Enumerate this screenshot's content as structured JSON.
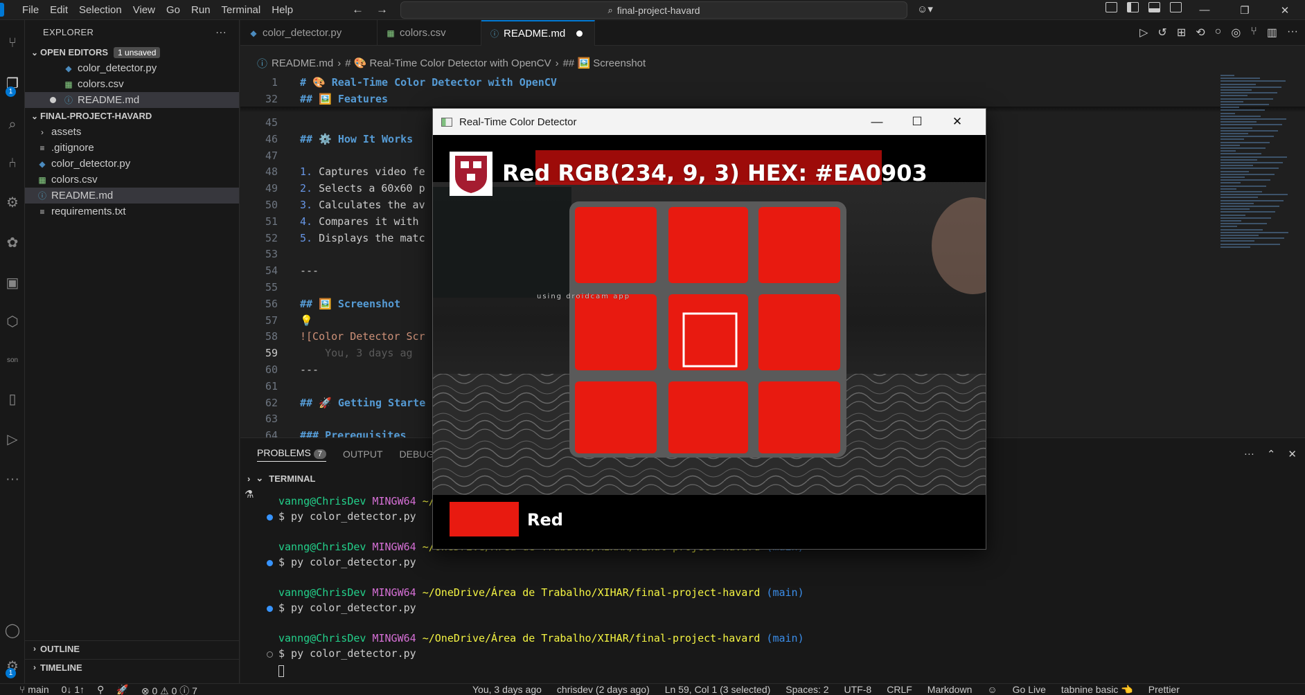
{
  "menu": [
    "File",
    "Edit",
    "Selection",
    "View",
    "Go",
    "Run",
    "Terminal",
    "Help"
  ],
  "search": {
    "text": "final-project-havard"
  },
  "explorer": {
    "title": "EXPLORER",
    "open_editors_label": "OPEN EDITORS",
    "unsaved_badge": "1 unsaved",
    "open_editors": [
      {
        "name": "color_detector.py",
        "type": "py"
      },
      {
        "name": "colors.csv",
        "type": "csv"
      },
      {
        "name": "README.md",
        "type": "md"
      }
    ],
    "project_label": "FINAL-PROJECT-HAVARD",
    "files": [
      {
        "name": "assets",
        "type": "folder"
      },
      {
        "name": ".gitignore",
        "type": "txt"
      },
      {
        "name": "color_detector.py",
        "type": "py"
      },
      {
        "name": "colors.csv",
        "type": "csv"
      },
      {
        "name": "README.md",
        "type": "md"
      },
      {
        "name": "requirements.txt",
        "type": "txt"
      }
    ],
    "outline_label": "OUTLINE",
    "timeline_label": "TIMELINE"
  },
  "tabs": [
    {
      "label": "color_detector.py",
      "type": "py"
    },
    {
      "label": "colors.csv",
      "type": "csv"
    },
    {
      "label": "README.md",
      "type": "md"
    }
  ],
  "breadcrumb": {
    "file": "README.md",
    "h1": "# 🎨 Real-Time Color Detector with OpenCV",
    "h2": "## 🖼️ Screenshot"
  },
  "editor": {
    "sticky": [
      {
        "n": "1",
        "mark": "# 🎨 ",
        "text": "Real-Time Color Detector with OpenCV"
      },
      {
        "n": "32",
        "mark": "## 🖼️ ",
        "text": "Features"
      }
    ],
    "lines": [
      {
        "n": "45",
        "kind": "blank",
        "text": ""
      },
      {
        "n": "46",
        "kind": "heading",
        "mark": "## ⚙️ ",
        "text": "How It Works"
      },
      {
        "n": "47",
        "kind": "blank",
        "text": ""
      },
      {
        "n": "48",
        "kind": "list",
        "mark": "1.",
        "text": " Captures video fe"
      },
      {
        "n": "49",
        "kind": "list",
        "mark": "2.",
        "text": " Selects a 60x60 p"
      },
      {
        "n": "50",
        "kind": "list",
        "mark": "3.",
        "text": " Calculates the av"
      },
      {
        "n": "51",
        "kind": "list",
        "mark": "4.",
        "text": " Compares it with "
      },
      {
        "n": "52",
        "kind": "list",
        "mark": "5.",
        "text": " Displays the matc"
      },
      {
        "n": "53",
        "kind": "blank",
        "text": ""
      },
      {
        "n": "54",
        "kind": "plain",
        "text": "---"
      },
      {
        "n": "55",
        "kind": "blank",
        "text": ""
      },
      {
        "n": "56",
        "kind": "heading",
        "mark": "## 🖼️ ",
        "text": "Screenshot"
      },
      {
        "n": "57",
        "kind": "plain",
        "text": "💡"
      },
      {
        "n": "58",
        "kind": "link",
        "text": "![Color Detector Scr"
      },
      {
        "n": "59",
        "kind": "ghost",
        "text": "    You, 3 days ag"
      },
      {
        "n": "60",
        "kind": "plain",
        "text": "---"
      },
      {
        "n": "61",
        "kind": "blank",
        "text": ""
      },
      {
        "n": "62",
        "kind": "heading",
        "mark": "## 🚀 ",
        "text": "Getting Starte"
      },
      {
        "n": "63",
        "kind": "blank",
        "text": ""
      },
      {
        "n": "64",
        "kind": "heading",
        "mark": "### ",
        "text": "Prerequisites"
      }
    ]
  },
  "panel": {
    "problems_label": "PROBLEMS",
    "problems_count": "7",
    "output_label": "OUTPUT",
    "debug_label": "DEBUG C",
    "terminal_label": "TERMINAL",
    "terminal": [
      {
        "user": "vanng@ChrisDev",
        "host": "MINGW64",
        "path": "~/",
        "branch": "",
        "cmd": "$ py color_detector.py"
      },
      {
        "user": "vanng@ChrisDev",
        "host": "MINGW64",
        "path": "~/OneDrive/Área de Trabalho/XIHAR/final-project-havard",
        "branch": "(main)",
        "cmd": "$ py color_detector.py"
      },
      {
        "user": "vanng@ChrisDev",
        "host": "MINGW64",
        "path": "~/OneDrive/Área de Trabalho/XIHAR/final-project-havard",
        "branch": "(main)",
        "cmd": "$ py color_detector.py"
      },
      {
        "user": "vanng@ChrisDev",
        "host": "MINGW64",
        "path": "~/OneDrive/Área de Trabalho/XIHAR/final-project-havard",
        "branch": "(main)",
        "cmd": "$ py color_detector.py"
      }
    ]
  },
  "status": {
    "branch": "main",
    "sync": "0↓ 1↑",
    "problems": "⊗ 0 ⚠ 0 ⓘ 7",
    "blame": "You, 3 days ago",
    "author": "chrisdev (2 days ago)",
    "position": "Ln 59, Col 1 (3 selected)",
    "spaces": "Spaces: 2",
    "encoding": "UTF-8",
    "eol": "CRLF",
    "language": "Markdown",
    "golive": "Go Live",
    "tabnine": "tabnine basic 👈",
    "prettier": "Prettier"
  },
  "cv_window": {
    "title": "Real-Time Color Detector",
    "overlay_text": "Red  RGB(234, 9, 3)  HEX: #EA0903",
    "watermark": "using droidcam app",
    "swatch_label": "Red",
    "detected_color": "#EA0903"
  },
  "colors": {
    "accent": "#0078d4",
    "cube_red": "#e81a10",
    "overlay_bg": "#b80d0b"
  }
}
